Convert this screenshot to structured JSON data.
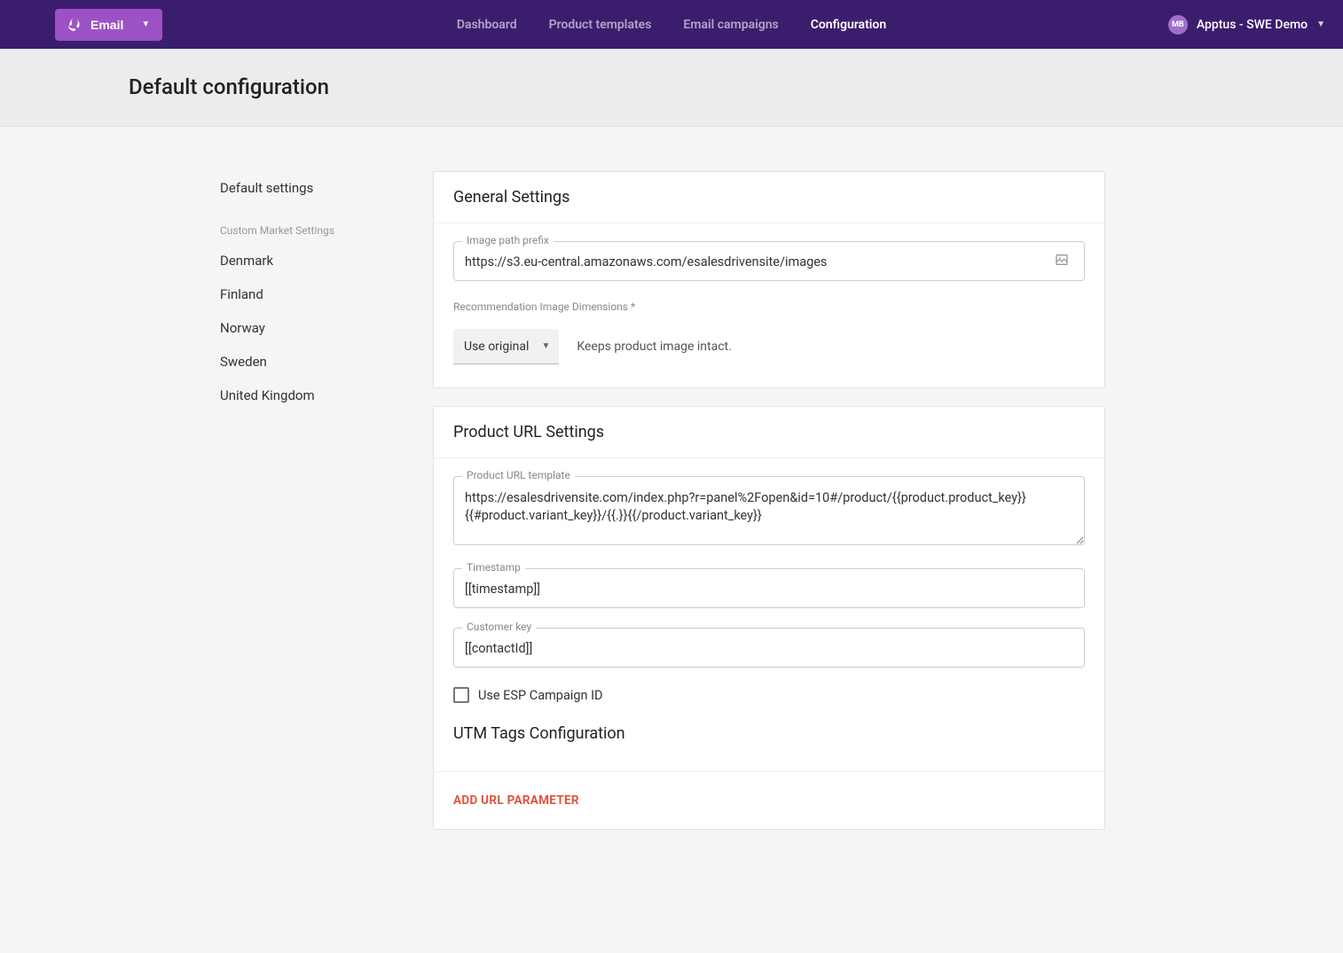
{
  "header": {
    "email_label": "Email",
    "nav": {
      "dashboard": "Dashboard",
      "product_templates": "Product templates",
      "email_campaigns": "Email campaigns",
      "configuration": "Configuration"
    },
    "avatar_initials": "MB",
    "account_label": "Apptus - SWE Demo"
  },
  "page_title": "Default configuration",
  "sidebar": {
    "default_settings": "Default settings",
    "custom_section": "Custom Market Settings",
    "markets": [
      "Denmark",
      "Finland",
      "Norway",
      "Sweden",
      "United Kingdom"
    ]
  },
  "general": {
    "title": "General Settings",
    "image_path_label": "Image path prefix",
    "image_path_value": "https://s3.eu-central.amazonaws.com/esalesdrivensite/images",
    "rec_dim_label": "Recommendation Image Dimensions *",
    "rec_dim_value": "Use original",
    "rec_dim_hint": "Keeps product image intact."
  },
  "product_url": {
    "title": "Product URL Settings",
    "template_label": "Product URL template",
    "template_value": "https://esalesdrivensite.com/index.php?r=panel%2Fopen&id=10#/product/{{product.product_key}}{{#product.variant_key}}/{{.}}{{/product.variant_key}}",
    "timestamp_label": "Timestamp",
    "timestamp_value": "[[timestamp]]",
    "customer_key_label": "Customer key",
    "customer_key_value": "[[contactId]]",
    "use_esp_label": "Use ESP Campaign ID"
  },
  "utm": {
    "title": "UTM Tags Configuration",
    "add_label": "Add URL parameter"
  }
}
